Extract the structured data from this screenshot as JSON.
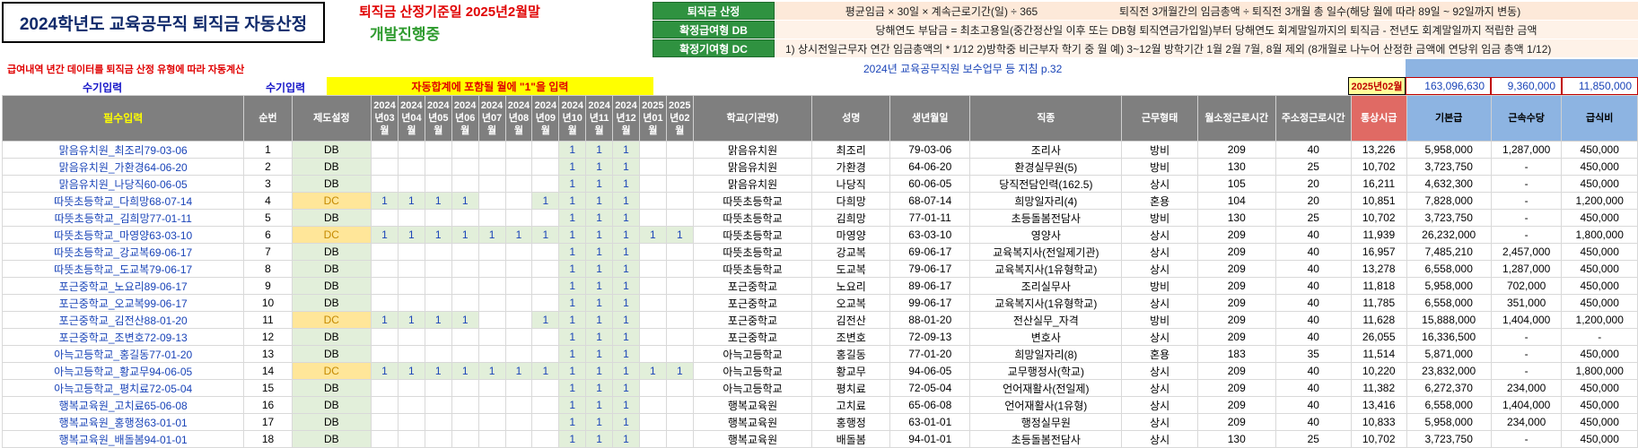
{
  "header": {
    "title": "2024학년도 교육공무직 퇴직금 자동산정",
    "calc_date": "퇴직금 산정기준일 2025년2월말",
    "dev_status": "개발진행중",
    "note": "급여내역 년간 데이터를 퇴직금 산정 유형에 따라 자동계산",
    "manual_input_1": "수기입력",
    "manual_input_2": "수기입력",
    "month_banner": "자동합계에 포함될 월에 \"1\"을 입력",
    "reference": "2024년 교육공무직원 보수업무 등 지침 p.32",
    "period": "2025년02월",
    "totals": [
      "163,096,630",
      "9,360,000",
      "11,850,000"
    ]
  },
  "info": [
    {
      "label": "퇴직금 산정",
      "text": "평균임금 × 30일 × 계속근로기간(일) ÷ 365",
      "text2": "퇴직전 3개월간의 임금총액 ÷ 퇴직전 3개월 총 일수(해당 월에 따라 89일 ~ 92일까지 변동)"
    },
    {
      "label": "확정급여형 DB",
      "text": "당해연도 부담금 = 최초고용일(중간정산일 이후 또는 DB형 퇴직연금가입일)부터 당해연도 회계말일까지의 퇴직금 - 전년도 회계말일까지 적립한 금액"
    },
    {
      "label": "확정기여형 DC",
      "text": "1) 상시전일근무자 연간 임금총액의 * 1/12     2)방학중 비근부자 학기 중 월 예) 3~12월 방학기간 1월 2월 7월, 8월 제외 (8개월로 나누어 산정한 금액에 연당위 임금 총액 1/12)"
    }
  ],
  "columns": {
    "required": "필수입력",
    "seq": "순번",
    "system": "제도설정",
    "months": [
      "2024년03월",
      "2024년04월",
      "2024년05월",
      "2024년06월",
      "2024년07월",
      "2024년08월",
      "2024년09월",
      "2024년10월",
      "2024년11월",
      "2024년12월",
      "2025년01월",
      "2025년02월"
    ],
    "school": "학교(기관명)",
    "name": "성명",
    "birth": "생년월일",
    "job": "직종",
    "work_type": "근무형태",
    "monthly_hours": "월소정근로시간",
    "weekly_hours": "주소정근로시간",
    "ordinary_hourly": "통상시급",
    "base_pay": "기본급",
    "seniority": "근속수당",
    "meal": "급식비"
  },
  "rows": [
    {
      "key": "맑음유치원_최조리79-03-06",
      "seq": "1",
      "sys": "DB",
      "m": [
        0,
        0,
        0,
        0,
        0,
        0,
        0,
        1,
        1,
        1,
        0,
        0
      ],
      "school": "맑음유치원",
      "name": "최조리",
      "birth": "79-03-06",
      "job": "조리사",
      "type": "방비",
      "mh": "209",
      "wh": "40",
      "ord": "13,226",
      "base": "5,958,000",
      "sen": "1,287,000",
      "meal": "450,000"
    },
    {
      "key": "맑음유치원_가환경64-06-20",
      "seq": "2",
      "sys": "DB",
      "m": [
        0,
        0,
        0,
        0,
        0,
        0,
        0,
        1,
        1,
        1,
        0,
        0
      ],
      "school": "맑음유치원",
      "name": "가환경",
      "birth": "64-06-20",
      "job": "환경실무원(5)",
      "type": "방비",
      "mh": "130",
      "wh": "25",
      "ord": "10,702",
      "base": "3,723,750",
      "sen": "-",
      "meal": "450,000"
    },
    {
      "key": "맑음유치원_나당직60-06-05",
      "seq": "3",
      "sys": "DB",
      "m": [
        0,
        0,
        0,
        0,
        0,
        0,
        0,
        1,
        1,
        1,
        0,
        0
      ],
      "school": "맑음유치원",
      "name": "나당직",
      "birth": "60-06-05",
      "job": "당직전담인력(162.5)",
      "type": "상시",
      "mh": "105",
      "wh": "20",
      "ord": "16,211",
      "base": "4,632,300",
      "sen": "-",
      "meal": "450,000"
    },
    {
      "key": "따뜻초등학교_다희망68-07-14",
      "seq": "4",
      "sys": "DC",
      "m": [
        1,
        1,
        1,
        1,
        0,
        0,
        1,
        1,
        1,
        1,
        0,
        0
      ],
      "school": "따뜻초등학교",
      "name": "다희망",
      "birth": "68-07-14",
      "job": "희망일자리(4)",
      "type": "혼용",
      "mh": "104",
      "wh": "20",
      "ord": "10,851",
      "base": "7,828,000",
      "sen": "-",
      "meal": "1,200,000"
    },
    {
      "key": "따뜻초등학교_김희망77-01-11",
      "seq": "5",
      "sys": "DB",
      "m": [
        0,
        0,
        0,
        0,
        0,
        0,
        0,
        1,
        1,
        1,
        0,
        0
      ],
      "school": "따뜻초등학교",
      "name": "김희망",
      "birth": "77-01-11",
      "job": "초등돌봄전담사",
      "type": "방비",
      "mh": "130",
      "wh": "25",
      "ord": "10,702",
      "base": "3,723,750",
      "sen": "-",
      "meal": "450,000"
    },
    {
      "key": "따뜻초등학교_마영양63-03-10",
      "seq": "6",
      "sys": "DC",
      "m": [
        1,
        1,
        1,
        1,
        1,
        1,
        1,
        1,
        1,
        1,
        1,
        1
      ],
      "school": "따뜻초등학교",
      "name": "마영양",
      "birth": "63-03-10",
      "job": "영양사",
      "type": "상시",
      "mh": "209",
      "wh": "40",
      "ord": "11,939",
      "base": "26,232,000",
      "sen": "-",
      "meal": "1,800,000"
    },
    {
      "key": "따뜻초등학교_강교복69-06-17",
      "seq": "7",
      "sys": "DB",
      "m": [
        0,
        0,
        0,
        0,
        0,
        0,
        0,
        1,
        1,
        1,
        0,
        0
      ],
      "school": "따뜻초등학교",
      "name": "강교복",
      "birth": "69-06-17",
      "job": "교육복지사(전일제기관)",
      "type": "상시",
      "mh": "209",
      "wh": "40",
      "ord": "16,957",
      "base": "7,485,210",
      "sen": "2,457,000",
      "meal": "450,000"
    },
    {
      "key": "따뜻초등학교_도교복79-06-17",
      "seq": "8",
      "sys": "DB",
      "m": [
        0,
        0,
        0,
        0,
        0,
        0,
        0,
        1,
        1,
        1,
        0,
        0
      ],
      "school": "따뜻초등학교",
      "name": "도교복",
      "birth": "79-06-17",
      "job": "교육복지사(1유형학교)",
      "type": "상시",
      "mh": "209",
      "wh": "40",
      "ord": "13,278",
      "base": "6,558,000",
      "sen": "1,287,000",
      "meal": "450,000"
    },
    {
      "key": "포근중학교_노요리89-06-17",
      "seq": "9",
      "sys": "DB",
      "m": [
        0,
        0,
        0,
        0,
        0,
        0,
        0,
        1,
        1,
        1,
        0,
        0
      ],
      "school": "포근중학교",
      "name": "노요리",
      "birth": "89-06-17",
      "job": "조리실무사",
      "type": "방비",
      "mh": "209",
      "wh": "40",
      "ord": "11,818",
      "base": "5,958,000",
      "sen": "702,000",
      "meal": "450,000"
    },
    {
      "key": "포근중학교_오교복99-06-17",
      "seq": "10",
      "sys": "DB",
      "m": [
        0,
        0,
        0,
        0,
        0,
        0,
        0,
        1,
        1,
        1,
        0,
        0
      ],
      "school": "포근중학교",
      "name": "오교복",
      "birth": "99-06-17",
      "job": "교육복지사(1유형학교)",
      "type": "상시",
      "mh": "209",
      "wh": "40",
      "ord": "11,785",
      "base": "6,558,000",
      "sen": "351,000",
      "meal": "450,000"
    },
    {
      "key": "포근중학교_김전산88-01-20",
      "seq": "11",
      "sys": "DC",
      "m": [
        1,
        1,
        1,
        1,
        0,
        0,
        1,
        1,
        1,
        1,
        0,
        0
      ],
      "school": "포근중학교",
      "name": "김전산",
      "birth": "88-01-20",
      "job": "전산실무_자격",
      "type": "방비",
      "mh": "209",
      "wh": "40",
      "ord": "11,628",
      "base": "15,888,000",
      "sen": "1,404,000",
      "meal": "1,200,000"
    },
    {
      "key": "포근중학교_조변호72-09-13",
      "seq": "12",
      "sys": "DB",
      "m": [
        0,
        0,
        0,
        0,
        0,
        0,
        0,
        1,
        1,
        1,
        0,
        0
      ],
      "school": "포근중학교",
      "name": "조변호",
      "birth": "72-09-13",
      "job": "변호사",
      "type": "상시",
      "mh": "209",
      "wh": "40",
      "ord": "26,055",
      "base": "16,336,500",
      "sen": "-",
      "meal": "-"
    },
    {
      "key": "아늑고등학교_홍길동77-01-20",
      "seq": "13",
      "sys": "DB",
      "m": [
        0,
        0,
        0,
        0,
        0,
        0,
        0,
        1,
        1,
        1,
        0,
        0
      ],
      "school": "아늑고등학교",
      "name": "홍길동",
      "birth": "77-01-20",
      "job": "희망일자리(8)",
      "type": "혼용",
      "mh": "183",
      "wh": "35",
      "ord": "11,514",
      "base": "5,871,000",
      "sen": "-",
      "meal": "450,000"
    },
    {
      "key": "아늑고등학교_황교무94-06-05",
      "seq": "14",
      "sys": "DC",
      "m": [
        1,
        1,
        1,
        1,
        1,
        1,
        1,
        1,
        1,
        1,
        1,
        1
      ],
      "school": "아늑고등학교",
      "name": "황교무",
      "birth": "94-06-05",
      "job": "교무행정사(학교)",
      "type": "상시",
      "mh": "209",
      "wh": "40",
      "ord": "10,220",
      "base": "23,832,000",
      "sen": "-",
      "meal": "1,800,000"
    },
    {
      "key": "아늑고등학교_평치료72-05-04",
      "seq": "15",
      "sys": "DB",
      "m": [
        0,
        0,
        0,
        0,
        0,
        0,
        0,
        1,
        1,
        1,
        0,
        0
      ],
      "school": "아늑고등학교",
      "name": "평치료",
      "birth": "72-05-04",
      "job": "언어재활사(전일제)",
      "type": "상시",
      "mh": "209",
      "wh": "40",
      "ord": "11,382",
      "base": "6,272,370",
      "sen": "234,000",
      "meal": "450,000"
    },
    {
      "key": "행복교육원_고치료65-06-08",
      "seq": "16",
      "sys": "DB",
      "m": [
        0,
        0,
        0,
        0,
        0,
        0,
        0,
        1,
        1,
        1,
        0,
        0
      ],
      "school": "행복교육원",
      "name": "고치료",
      "birth": "65-06-08",
      "job": "언어재활사(1유형)",
      "type": "상시",
      "mh": "209",
      "wh": "40",
      "ord": "13,416",
      "base": "6,558,000",
      "sen": "1,404,000",
      "meal": "450,000"
    },
    {
      "key": "행복교육원_홍행정63-01-01",
      "seq": "17",
      "sys": "DB",
      "m": [
        0,
        0,
        0,
        0,
        0,
        0,
        0,
        1,
        1,
        1,
        0,
        0
      ],
      "school": "행복교육원",
      "name": "홍행정",
      "birth": "63-01-01",
      "job": "행정실무원",
      "type": "상시",
      "mh": "209",
      "wh": "40",
      "ord": "10,833",
      "base": "5,958,000",
      "sen": "234,000",
      "meal": "450,000"
    },
    {
      "key": "행복교육원_배돌봄94-01-01",
      "seq": "18",
      "sys": "DB",
      "m": [
        0,
        0,
        0,
        0,
        0,
        0,
        0,
        1,
        1,
        1,
        0,
        0
      ],
      "school": "행복교육원",
      "name": "배돌봄",
      "birth": "94-01-01",
      "job": "초등돌봄전담사",
      "type": "상시",
      "mh": "130",
      "wh": "25",
      "ord": "10,702",
      "base": "3,723,750",
      "sen": "-",
      "meal": "450,000"
    }
  ]
}
